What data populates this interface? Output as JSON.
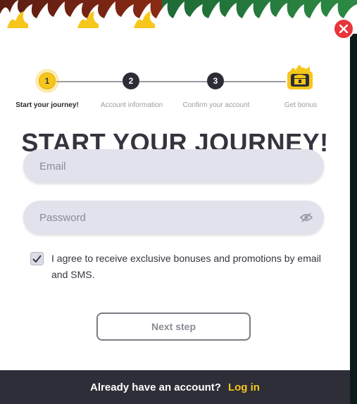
{
  "header": {
    "close_icon": "close-icon"
  },
  "colors": {
    "accent": "#f7c61a",
    "close": "#e8353b",
    "footer_bg": "#2e2e38"
  },
  "stepper": {
    "steps": [
      {
        "number": "1",
        "label": "Start your journey!",
        "state": "active"
      },
      {
        "number": "2",
        "label": "Account information",
        "state": "pending"
      },
      {
        "number": "3",
        "label": "Confirm your account",
        "state": "pending"
      },
      {
        "number": "",
        "label": "Get bonus",
        "state": "pending",
        "icon": "treasure-chest-icon"
      }
    ]
  },
  "form": {
    "title": "START YOUR JOURNEY!",
    "email_placeholder": "Email",
    "email_value": "",
    "password_placeholder": "Password",
    "password_value": "",
    "password_icon": "eye-off-icon",
    "consent_checked": true,
    "consent_text": "I agree to receive exclusive bonuses and promotions by email and SMS.",
    "next_label": "Next step"
  },
  "footer": {
    "prompt": "Already have an account?",
    "login_label": "Log in"
  }
}
